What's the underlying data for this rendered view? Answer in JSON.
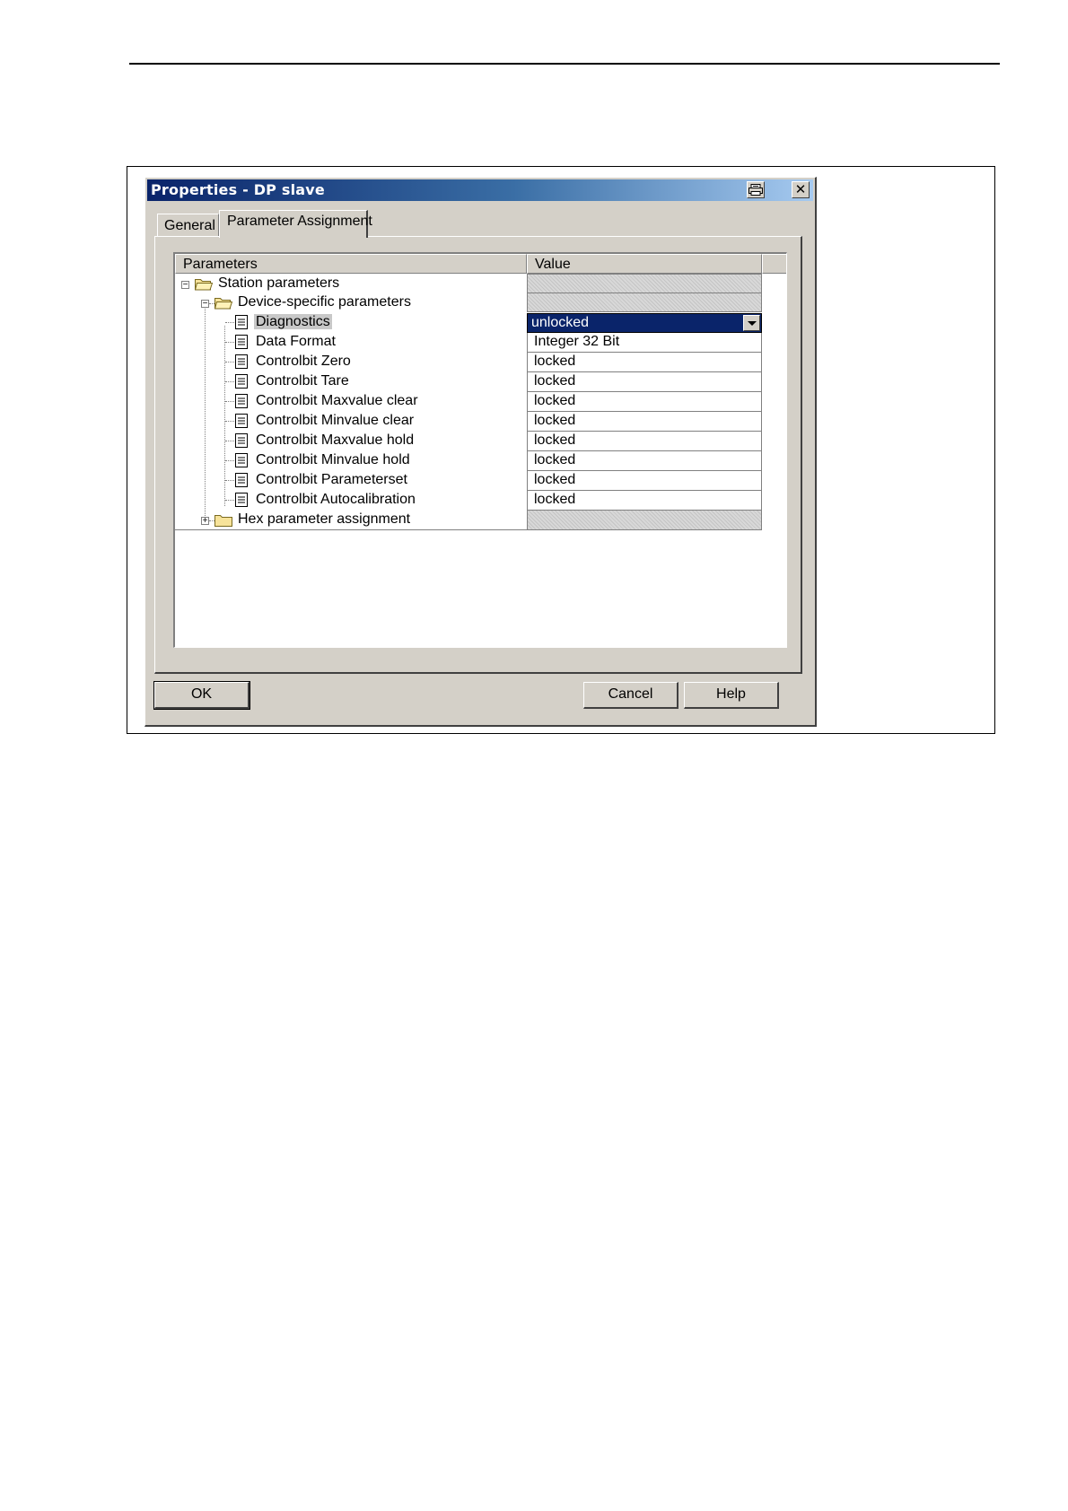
{
  "dialog": {
    "title": "Properties - DP slave",
    "icons": {
      "print": "print-icon",
      "close": "close-icon"
    },
    "close_glyph": "✕",
    "tabs": [
      "General",
      "Parameter Assignment"
    ],
    "active_tab": "Parameter Assignment",
    "columns": {
      "parameters": "Parameters",
      "value": "Value"
    },
    "tree": {
      "station": "Station parameters",
      "device": "Device-specific parameters",
      "hex": "Hex parameter assignment"
    },
    "parameters": [
      {
        "label": "Diagnostics",
        "value": "unlocked",
        "selected": true,
        "dropdown": true
      },
      {
        "label": "Data Format",
        "value": "Integer 32 Bit"
      },
      {
        "label": "Controlbit Zero",
        "value": "locked"
      },
      {
        "label": "Controlbit Tare",
        "value": "locked"
      },
      {
        "label": "Controlbit Maxvalue clear",
        "value": "locked"
      },
      {
        "label": "Controlbit Minvalue clear",
        "value": "locked"
      },
      {
        "label": "Controlbit Maxvalue hold",
        "value": "locked"
      },
      {
        "label": "Controlbit Minvalue hold",
        "value": "locked"
      },
      {
        "label": "Controlbit Parameterset",
        "value": "locked"
      },
      {
        "label": "Controlbit Autocalibration",
        "value": "locked"
      }
    ],
    "buttons": {
      "ok": "OK",
      "cancel": "Cancel",
      "help": "Help"
    },
    "colors": {
      "titlebar": "#0a246a",
      "selection": "#0a246a",
      "face": "#d4d0c8"
    }
  }
}
